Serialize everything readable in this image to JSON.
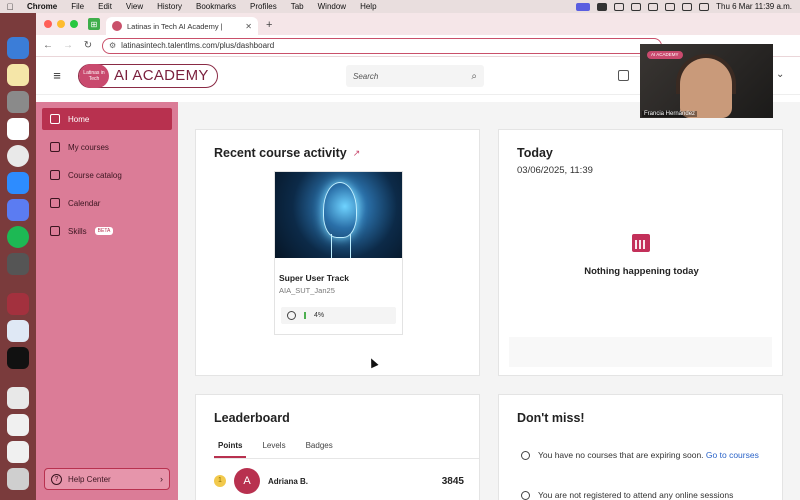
{
  "menubar": {
    "app": "Chrome",
    "items": [
      "File",
      "Edit",
      "View",
      "History",
      "Bookmarks",
      "Profiles",
      "Tab",
      "Window",
      "Help"
    ],
    "clock": "Thu 6 Mar  11:39 a.m."
  },
  "browser": {
    "tab_title": "Latinas in Tech AI Academy |",
    "url": "latinasintech.talentlms.com/plus/dashboard"
  },
  "header": {
    "brand_badge": "Latinas in Tech",
    "brand_name": "AI ACADEMY",
    "search_placeholder": "Search"
  },
  "sidebar": {
    "items": [
      {
        "label": "Home",
        "icon": "home-icon"
      },
      {
        "label": "My courses",
        "icon": "book-icon"
      },
      {
        "label": "Course catalog",
        "icon": "catalog-icon"
      },
      {
        "label": "Calendar",
        "icon": "calendar-icon"
      },
      {
        "label": "Skills",
        "icon": "skills-icon",
        "badge": "BETA"
      }
    ],
    "help": "Help Center"
  },
  "recent": {
    "title": "Recent course activity",
    "course_name": "Super User Track",
    "course_code": "AIA_SUT_Jan25",
    "progress_text": "4%",
    "progress": 0.04
  },
  "today": {
    "title": "Today",
    "date": "03/06/2025, 11:39",
    "empty": "Nothing happening today"
  },
  "leaderboard": {
    "title": "Leaderboard",
    "tabs": [
      "Points",
      "Levels",
      "Badges"
    ],
    "rows": [
      {
        "rank": "1",
        "initial": "A",
        "name": "Adriana B.",
        "score": "3845"
      }
    ]
  },
  "dontmiss": {
    "title": "Don't miss!",
    "line1": "You have no courses that are expiring soon.",
    "link1": "Go to courses",
    "line2": "You are not registered to attend any online sessions"
  },
  "video": {
    "tag": "AI ACADEMY",
    "name": "Francia Hernández"
  },
  "colors": {
    "accent": "#b8314f",
    "sidebar": "#db7c97",
    "brand": "#7a1f3d"
  }
}
